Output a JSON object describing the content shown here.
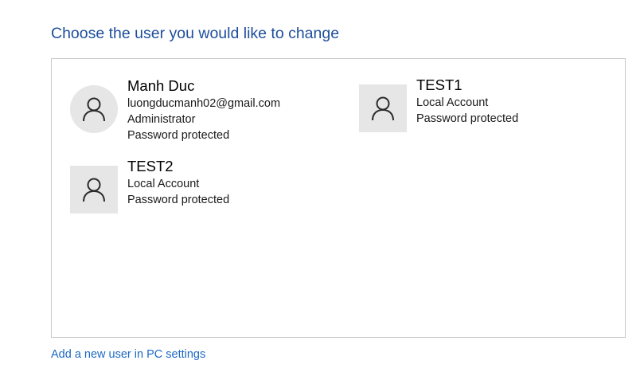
{
  "header": {
    "title": "Choose the user you would like to change"
  },
  "accounts": [
    {
      "name": "Manh Duc",
      "details": [
        "luongducmanh02@gmail.com",
        "Administrator",
        "Password protected"
      ],
      "avatar_icon": "user-icon"
    },
    {
      "name": "TEST1",
      "details": [
        "Local Account",
        "Password protected"
      ],
      "avatar_icon": "user-icon"
    },
    {
      "name": "TEST2",
      "details": [
        "Local Account",
        "Password protected"
      ],
      "avatar_icon": "user-icon"
    }
  ],
  "footer": {
    "add_user_link": "Add a new user in PC settings"
  },
  "colors": {
    "title": "#1e4e9c",
    "link": "#1c69c4",
    "avatar_background": "#e6e6e6",
    "panel_border": "#c9c9c9"
  }
}
